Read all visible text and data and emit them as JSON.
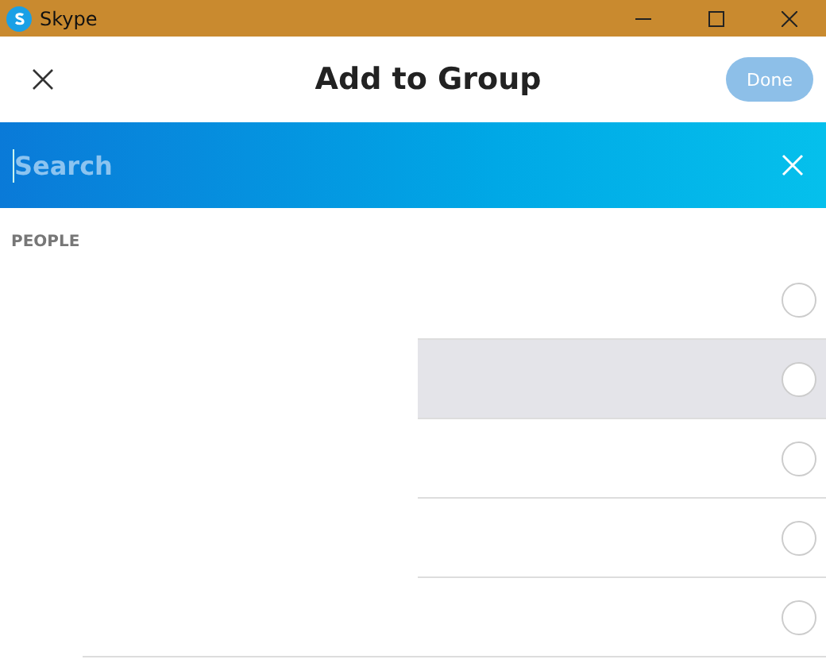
{
  "window": {
    "title": "Skype"
  },
  "header": {
    "title": "Add to Group",
    "done_button": "Done",
    "done_disabled": true
  },
  "search": {
    "placeholder": "Search"
  },
  "section": "PEOPLE",
  "people": [
    {
      "highlighted": false,
      "checked": false
    },
    {
      "highlighted": true,
      "checked": false
    },
    {
      "highlighted": false,
      "checked": false
    },
    {
      "highlighted": false,
      "checked": false
    },
    {
      "highlighted": false,
      "checked": false
    }
  ]
}
